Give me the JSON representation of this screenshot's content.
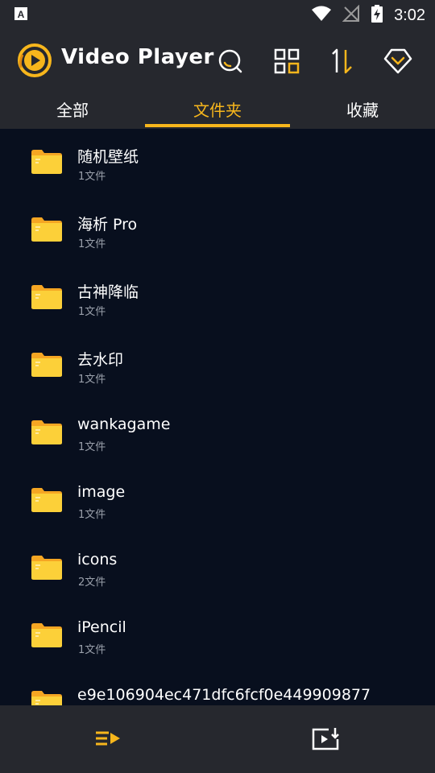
{
  "status_bar": {
    "time": "3:02",
    "icons": [
      "a-notification-icon",
      "wifi-icon",
      "no-signal-icon",
      "battery-charging-icon"
    ]
  },
  "header": {
    "title": "Video Player",
    "actions": [
      "search-icon",
      "grid-view-icon",
      "sort-icon",
      "vip-icon"
    ],
    "accent_color": "#f7b61c"
  },
  "tabs": [
    {
      "label": "全部",
      "active": false
    },
    {
      "label": "文件夹",
      "active": true
    },
    {
      "label": "收藏",
      "active": false
    }
  ],
  "folders": [
    {
      "name": "随机壁纸",
      "count": "1文件"
    },
    {
      "name": "海析 Pro",
      "count": "1文件"
    },
    {
      "name": "古神降临",
      "count": "1文件"
    },
    {
      "name": "去水印",
      "count": "1文件"
    },
    {
      "name": "wankagame",
      "count": "1文件"
    },
    {
      "name": "image",
      "count": "1文件"
    },
    {
      "name": "icons",
      "count": "2文件"
    },
    {
      "name": "iPencil",
      "count": "1文件"
    },
    {
      "name": "e9e106904ec471dfc6fcf0e449909877",
      "count": ""
    }
  ],
  "bottom_nav": [
    "playlist-icon",
    "video-import-icon"
  ]
}
